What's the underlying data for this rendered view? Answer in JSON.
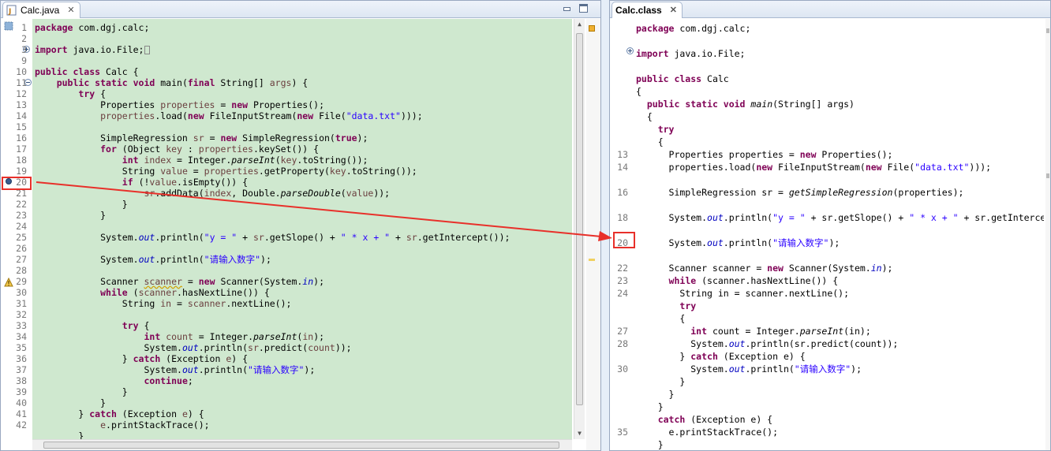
{
  "left_editor": {
    "tab_title": "Calc.java",
    "tab_close_glyph": "✕",
    "line_numbers": [
      "1",
      "2",
      "3",
      "9",
      "10",
      "11",
      "12",
      "13",
      "14",
      "15",
      "16",
      "17",
      "18",
      "19",
      "20",
      "21",
      "22",
      "23",
      "24",
      "25",
      "26",
      "27",
      "28",
      "29",
      "30",
      "31",
      "32",
      "33",
      "34",
      "35",
      "36",
      "37",
      "38",
      "39",
      "40",
      "41",
      "42"
    ],
    "highlight_line_number": "20"
  },
  "right_editor": {
    "tab_title": "Calc.class",
    "tab_close_glyph": "✕",
    "line_numbers": [
      "",
      "",
      "",
      "",
      "",
      "",
      "",
      "",
      "",
      "",
      "13",
      "14",
      "",
      "16",
      "",
      "18",
      "",
      "20",
      "",
      "22",
      "23",
      "24",
      "",
      "",
      "27",
      "28",
      "",
      "30",
      "",
      "",
      "",
      "",
      "35",
      ""
    ],
    "highlight_line_number": "20"
  },
  "colors": {
    "keyword": "#7f0055",
    "string": "#2a00ff",
    "field": "#0000c0",
    "local_var": "#6a3e3e",
    "code_bg_left": "#cfe8cf",
    "annotation_red": "#e8302a"
  },
  "icons": [
    "java-file-icon",
    "class-file-icon",
    "breakpoint-icon",
    "bookmark-icon",
    "warning-icon",
    "fold-expand-icon",
    "fold-collapse-icon",
    "minimize-icon",
    "maximize-icon"
  ]
}
